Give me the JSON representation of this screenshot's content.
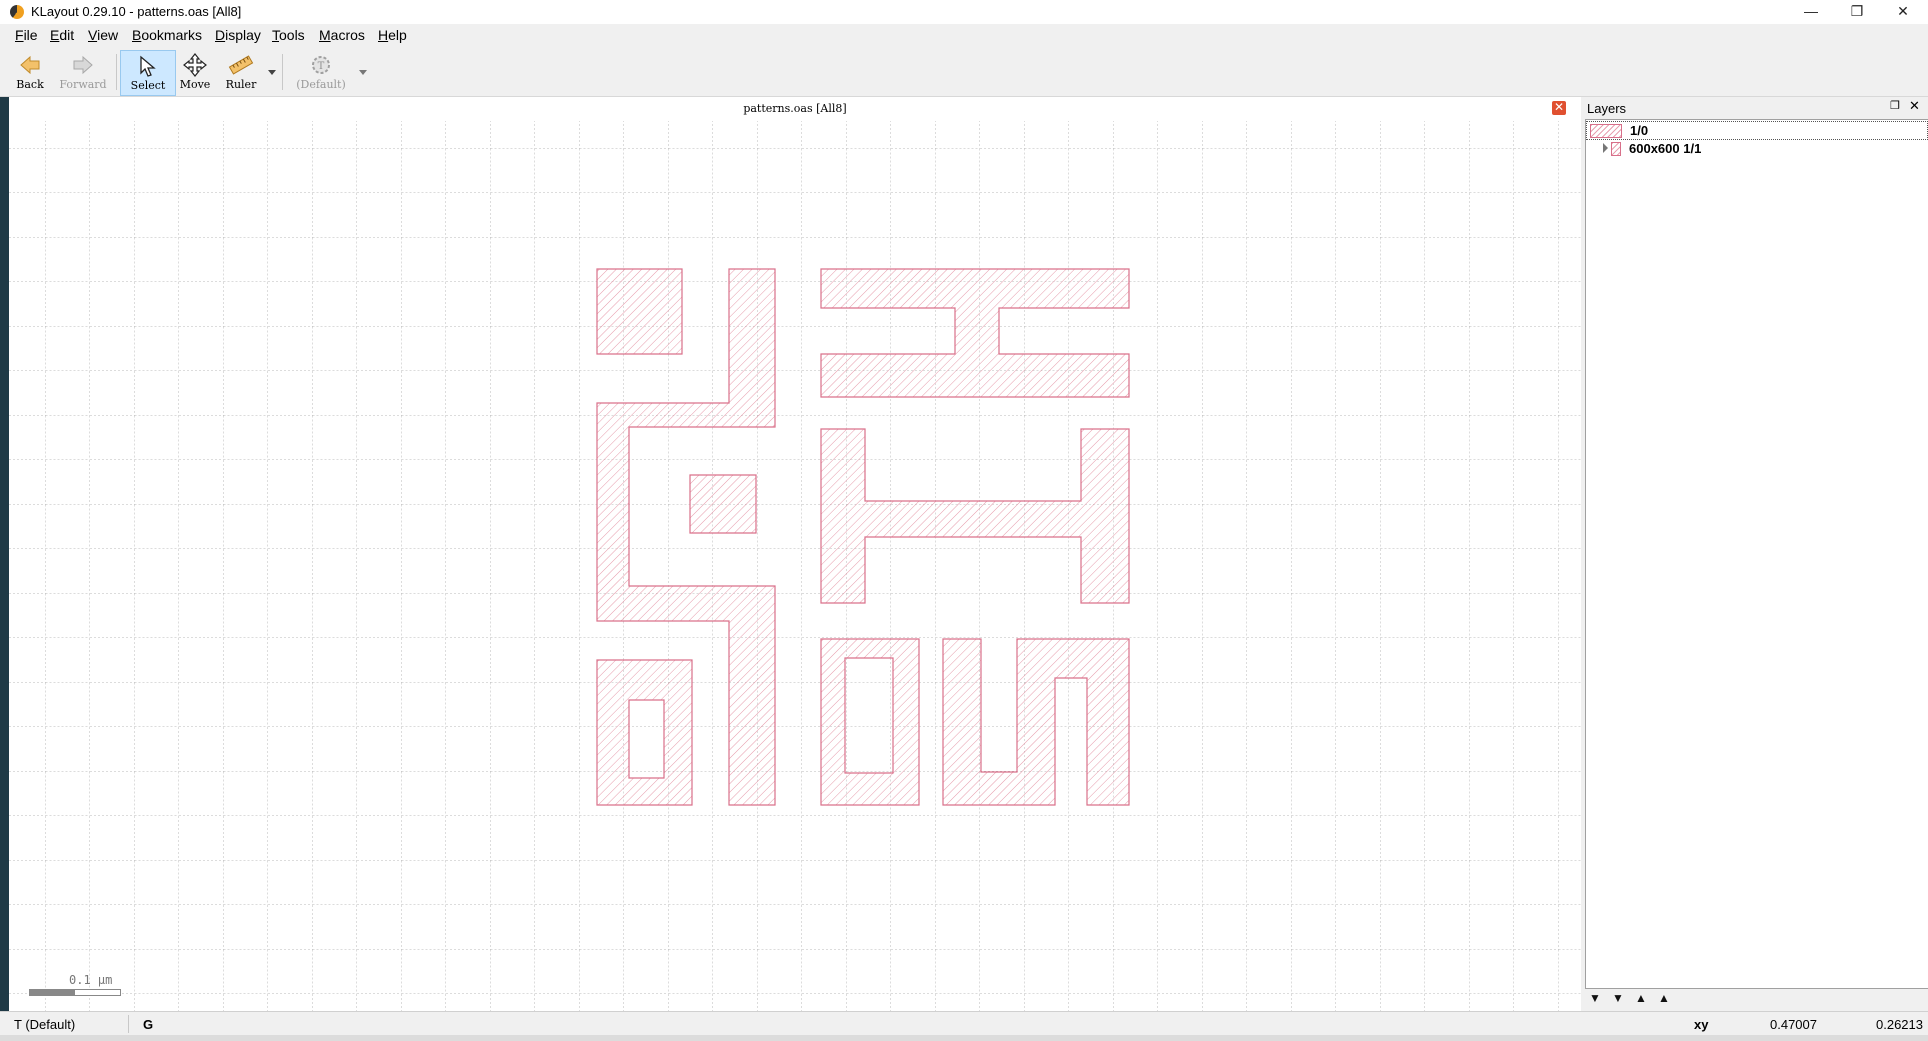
{
  "window": {
    "title": "KLayout 0.29.10 - patterns.oas [All8]",
    "minimize_icon": "minimize-icon",
    "maximize_icon": "restore-icon",
    "close_icon": "close-icon"
  },
  "menu": [
    {
      "label": "File",
      "key": "F",
      "rest": "ile"
    },
    {
      "label": "Edit",
      "key": "E",
      "rest": "dit"
    },
    {
      "label": "View",
      "key": "V",
      "rest": "iew"
    },
    {
      "label": "Bookmarks",
      "key": "B",
      "rest": "ookmarks"
    },
    {
      "label": "Display",
      "key": "D",
      "rest": "isplay"
    },
    {
      "label": "Tools",
      "key": "T",
      "rest": "ools"
    },
    {
      "label": "Macros",
      "key": "M",
      "rest": "acros"
    },
    {
      "label": "Help",
      "key": "H",
      "rest": "elp"
    }
  ],
  "toolbar": {
    "back": {
      "label": "Back",
      "icon": "back-arrow-icon",
      "enabled": true
    },
    "forward": {
      "label": "Forward",
      "icon": "forward-arrow-icon",
      "enabled": false
    },
    "select": {
      "label": "Select",
      "icon": "pointer-icon",
      "active": true
    },
    "move": {
      "label": "Move",
      "icon": "move-cross-icon"
    },
    "ruler": {
      "label": "Ruler",
      "icon": "ruler-icon"
    },
    "default_mode": {
      "label": "(Default)",
      "icon": "gear-icon",
      "enabled": false
    }
  },
  "canvas": {
    "title": "patterns.oas [All8]",
    "close_icon": "close-icon",
    "scale_label": "0.1 µm",
    "layer_fill": "#e27a90",
    "grid_color": "#b8b8b8"
  },
  "layers_panel": {
    "title": "Layers",
    "float_icon": "float-icon",
    "close_icon": "close-icon",
    "layers": [
      {
        "name": "1/0",
        "selected": true,
        "expandable": false
      },
      {
        "name": "600x600 1/1",
        "selected": false,
        "expandable": true
      }
    ],
    "buttons": [
      "move-bottom-icon",
      "move-down-icon",
      "move-up-icon",
      "move-top-icon"
    ]
  },
  "status": {
    "mode": "T (Default)",
    "grid": "G",
    "coord_label": "xy",
    "x": "0.47007",
    "y": "0.26213"
  }
}
